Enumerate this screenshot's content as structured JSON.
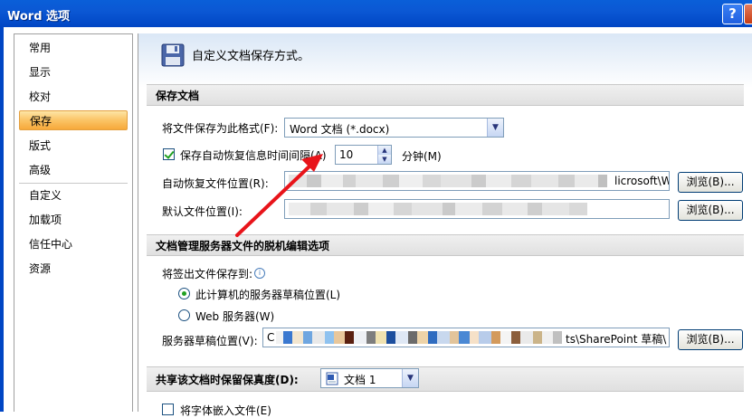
{
  "window": {
    "title": "Word 选项",
    "help_label": "?",
    "close_label": ""
  },
  "sidebar": {
    "items": [
      {
        "label": "常用"
      },
      {
        "label": "显示"
      },
      {
        "label": "校对"
      },
      {
        "label": "保存"
      },
      {
        "label": "版式"
      },
      {
        "label": "高级"
      },
      {
        "label": "自定义"
      },
      {
        "label": "加载项"
      },
      {
        "label": "信任中心"
      },
      {
        "label": "资源"
      }
    ],
    "active": "保存"
  },
  "header": {
    "icon": "floppy-disk-icon",
    "text": "自定义文档保存方式。"
  },
  "save_docs": {
    "section_title": "保存文档",
    "format_label": "将文件保存为此格式(F):",
    "format_value": "Word 文档 (*.docx)",
    "autorecover_checkbox_label": "保存自动恢复信息时间间隔(A)",
    "autorecover_checked": true,
    "autorecover_minutes": "10",
    "minutes_label": "分钟(M)",
    "autorecover_location_label": "自动恢复文件位置(R):",
    "autorecover_location_value": "licrosoft\\W",
    "default_location_label": "默认文件位置(I):",
    "browse_label": "浏览(B)..."
  },
  "offline_editing": {
    "section_title": "文档管理服务器文件的脱机编辑选项",
    "checkout_label": "将签出文件保存到:",
    "option_local": "此计算机的服务器草稿位置(L)",
    "option_web": "Web 服务器(W)",
    "selected": "local",
    "drafts_location_label": "服务器草稿位置(V):",
    "drafts_location_prefix": "C",
    "drafts_location_suffix": "ts\\SharePoint 草稿\\",
    "browse_label": "浏览(B)..."
  },
  "fidelity": {
    "section_title": "共享该文档时保留保真度(D):",
    "document_value": "文档 1",
    "document_icon": "word-document-icon",
    "embed_fonts_label": "将字体嵌入文件(E)",
    "embed_fonts_checked": false
  },
  "annotation": {
    "arrow_color": "#e8141a"
  }
}
